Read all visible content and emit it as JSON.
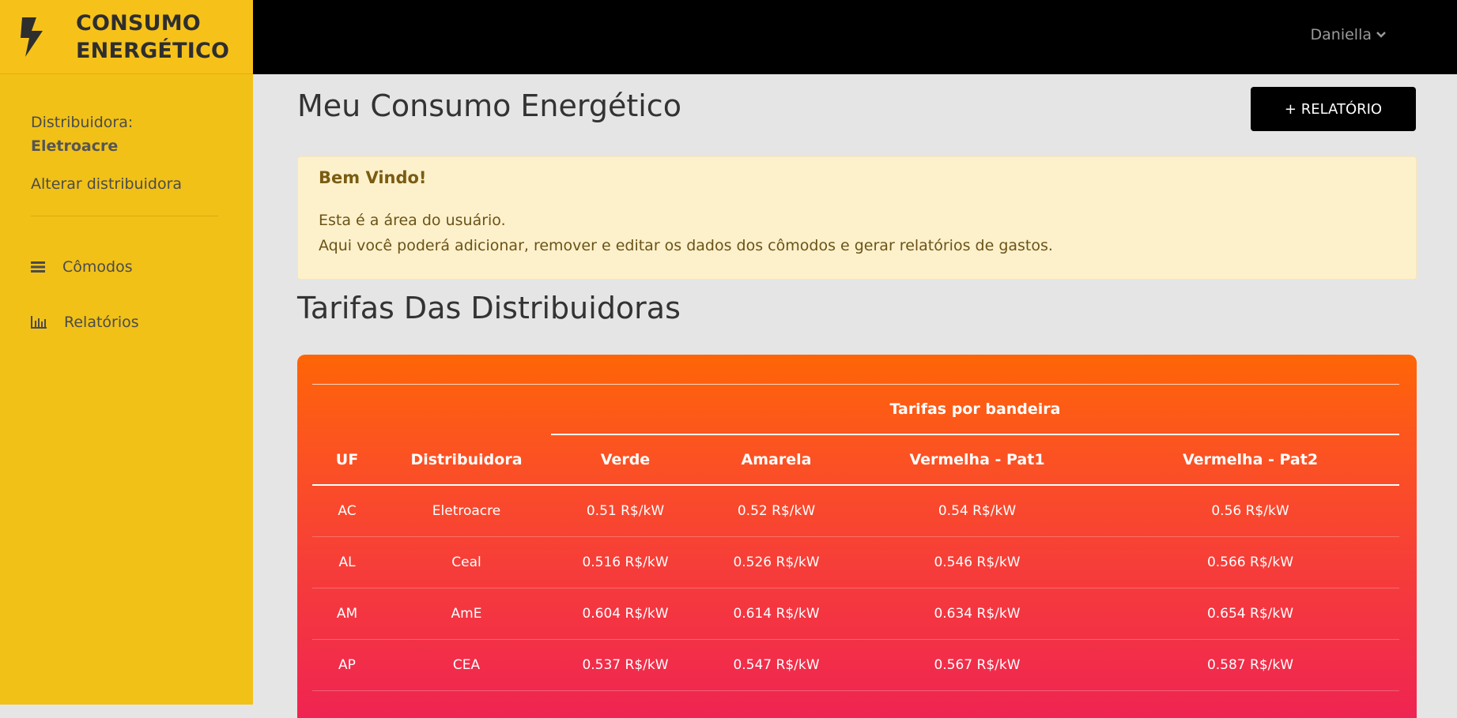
{
  "brand": {
    "line1": "CONSUMO",
    "line2": "ENERGÉTICO"
  },
  "sidebar": {
    "distribuidora_label": "Distribuidora:",
    "distribuidora_name": "Eletroacre",
    "alterar": "Alterar distribuidora",
    "items": [
      {
        "label": "Cômodos",
        "icon": "list-icon"
      },
      {
        "label": "Relatórios",
        "icon": "bar-chart-icon"
      }
    ]
  },
  "topbar": {
    "user": "Daniella"
  },
  "main": {
    "title": "Meu Consumo Energético",
    "button": "+ RELATÓRIO",
    "alert": {
      "heading": "Bem Vindo!",
      "line1": "Esta é a área do usuário.",
      "line2": "Aqui você poderá adicionar, remover e editar os dados dos cômodos e gerar relatórios de gastos."
    },
    "section_title": "Tarifas Das Distribuidoras",
    "table": {
      "group_header": "Tarifas por bandeira",
      "columns": [
        "UF",
        "Distribuidora",
        "Verde",
        "Amarela",
        "Vermelha - Pat1",
        "Vermelha - Pat2"
      ],
      "rows": [
        [
          "AC",
          "Eletroacre",
          "0.51 R$/kW",
          "0.52 R$/kW",
          "0.54 R$/kW",
          "0.56 R$/kW"
        ],
        [
          "AL",
          "Ceal",
          "0.516 R$/kW",
          "0.526 R$/kW",
          "0.546 R$/kW",
          "0.566 R$/kW"
        ],
        [
          "AM",
          "AmE",
          "0.604 R$/kW",
          "0.614 R$/kW",
          "0.634 R$/kW",
          "0.654 R$/kW"
        ],
        [
          "AP",
          "CEA",
          "0.537 R$/kW",
          "0.547 R$/kW",
          "0.567 R$/kW",
          "0.587 R$/kW"
        ]
      ]
    }
  },
  "colors": {
    "sidebar": "#f1c118",
    "topbar": "#000000",
    "table_gradient_top": "#fe6506",
    "table_gradient_bottom": "#ef2452",
    "alert_bg": "#fdf1cc"
  }
}
